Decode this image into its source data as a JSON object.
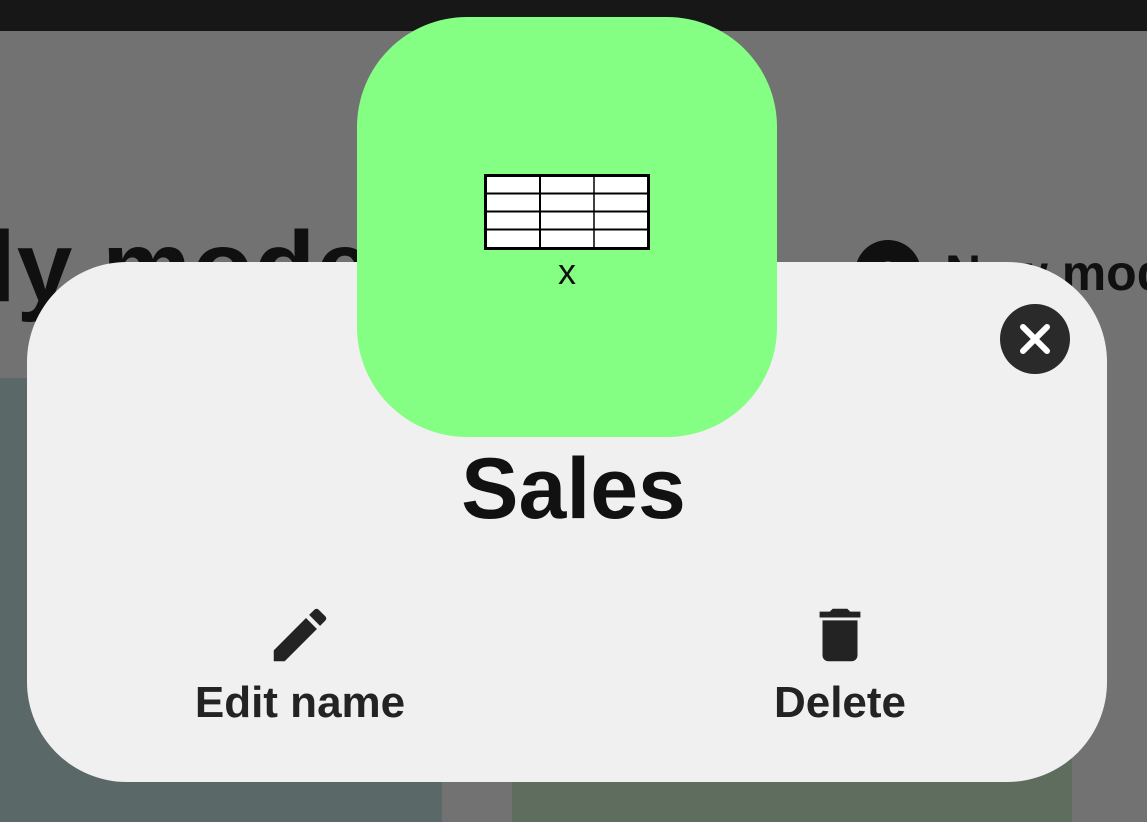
{
  "background": {
    "title_fragment": "ly mode",
    "new_model_label": "New mod",
    "plus_glyph": "+"
  },
  "dialog": {
    "tile_color": "#85fe84",
    "tile_icon": "table-icon",
    "tile_caption": "x",
    "model_name": "Sales",
    "close_icon": "close-icon",
    "actions": [
      {
        "label": "Edit name",
        "icon": "pencil-icon"
      },
      {
        "label": "Delete",
        "icon": "trash-icon"
      }
    ]
  }
}
